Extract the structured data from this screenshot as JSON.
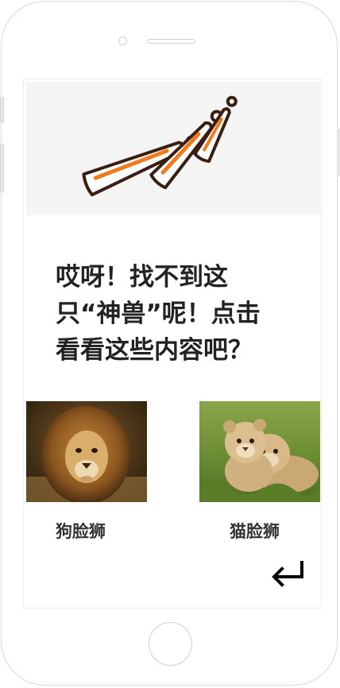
{
  "message": {
    "line1": "哎呀！找不到这",
    "line2": "只“神兽”呢！点击",
    "line3": "看看这些内容吧？"
  },
  "recommendations": [
    {
      "label": "狗脸狮",
      "image_icon": "lion-photo"
    },
    {
      "label": "猫脸狮",
      "image_icon": "lion-cubs-photo"
    }
  ],
  "icons": {
    "banner": "exclamation-marks-illustration",
    "back": "return-arrow-icon"
  },
  "colors": {
    "text": "#222222",
    "banner_bg": "#f4f4f4",
    "accent": "#f07a1c",
    "outline": "#3a1e12"
  }
}
